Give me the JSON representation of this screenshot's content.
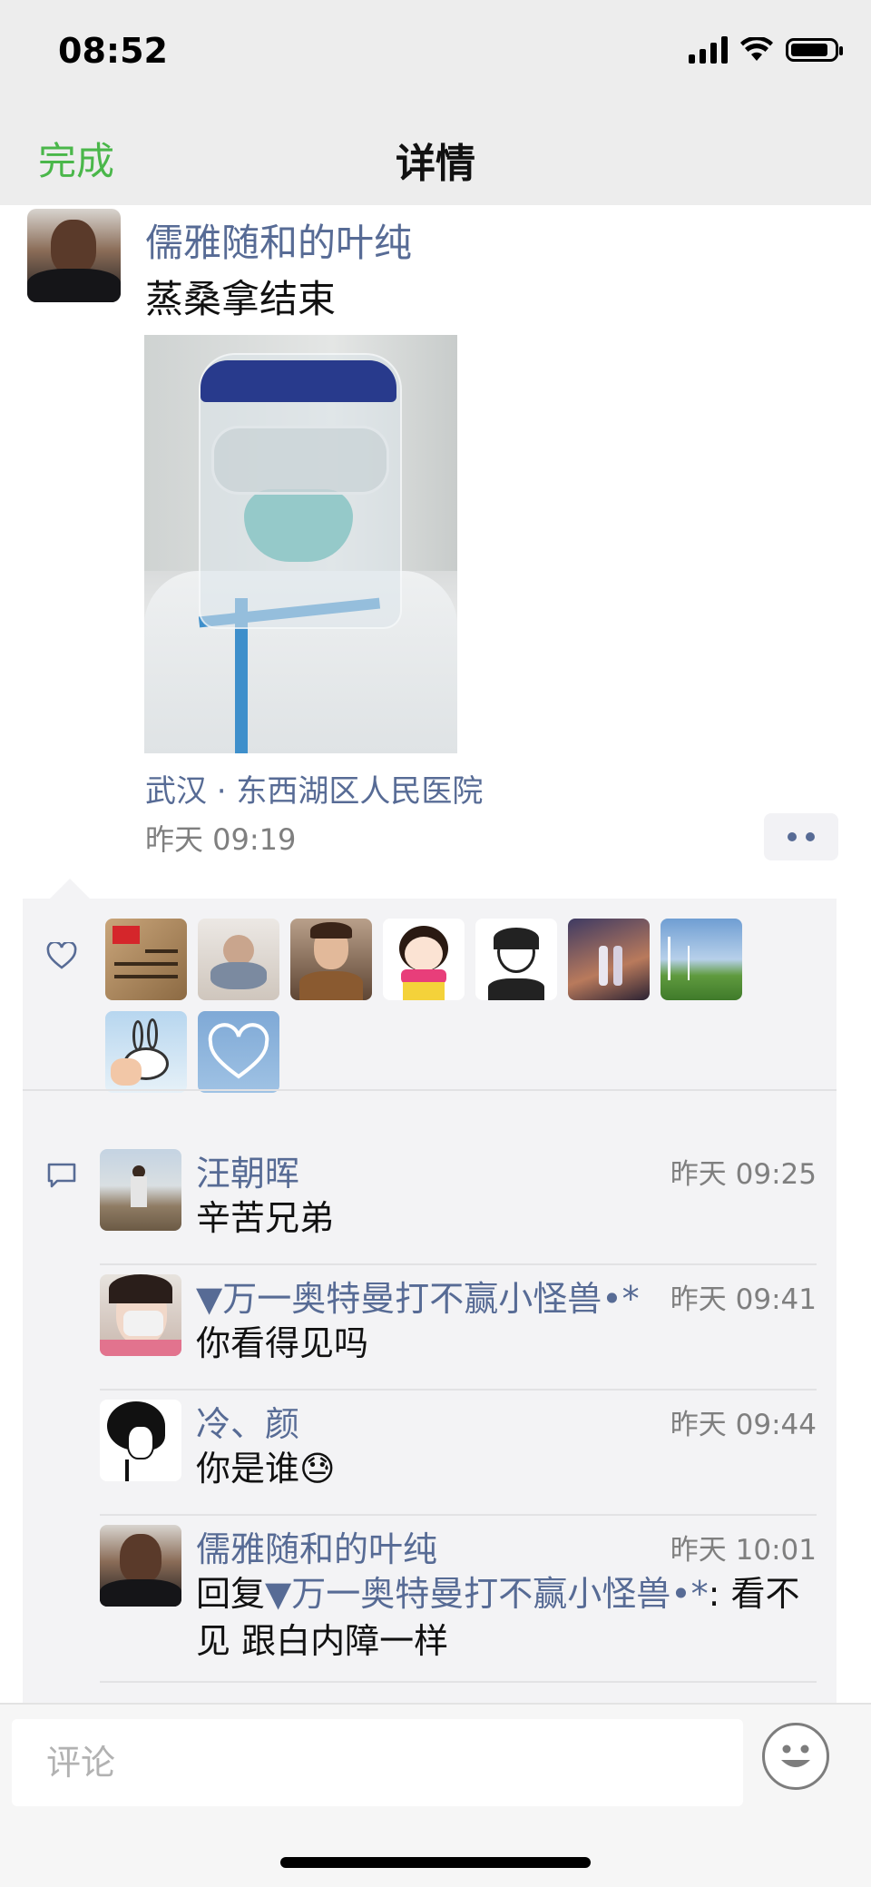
{
  "status_bar": {
    "time": "08:52"
  },
  "nav": {
    "done_label": "完成",
    "title": "详情"
  },
  "post": {
    "author": "儒雅随和的叶纯",
    "text": "蒸桑拿结束",
    "location": "武汉 · 东西湖区人民医院",
    "time": "昨天 09:19"
  },
  "likes": {
    "avatars": [
      "flag-calligraphy",
      "baby-figurine",
      "boy-portrait",
      "cartoon-girl",
      "line-art-girl",
      "night-street",
      "wind-turbine",
      "bunny-hand",
      "heart-sky"
    ]
  },
  "comments": [
    {
      "name": "汪朝晖",
      "time": "昨天 09:25",
      "text": "辛苦兄弟"
    },
    {
      "name": "▼万一奥特曼打不赢小怪兽•*",
      "time": "昨天 09:41",
      "text": "你看得见吗"
    },
    {
      "name": "冷、颜",
      "time": "昨天 09:44",
      "text": "你是谁😓"
    },
    {
      "name": "儒雅随和的叶纯",
      "time": "昨天 10:01",
      "reply_prefix": "回复",
      "reply_to": "▼万一奥特曼打不赢小怪兽•*",
      "text": ": 看不见 跟白内障一样"
    }
  ],
  "comment_bar": {
    "placeholder": "评论"
  },
  "colors": {
    "accent_green": "#4ab74a",
    "name_blue": "#576b95"
  }
}
